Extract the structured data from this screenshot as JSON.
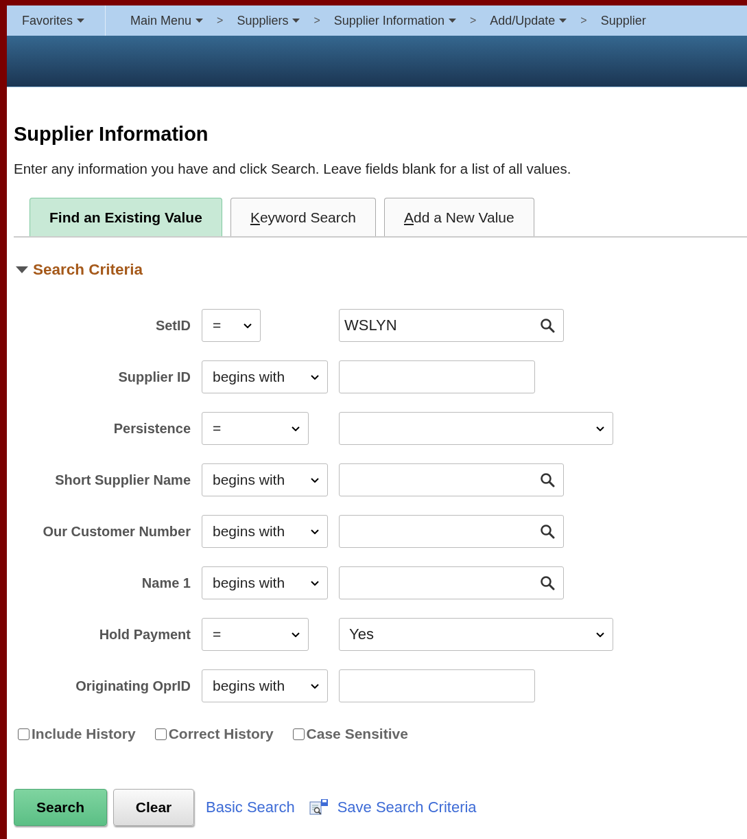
{
  "breadcrumbs": [
    {
      "label": "Favorites",
      "dropdown": true,
      "separator": false
    },
    {
      "label": "Main Menu",
      "dropdown": true,
      "separator": false
    },
    {
      "label": "Suppliers",
      "dropdown": true,
      "separator": true
    },
    {
      "label": "Supplier Information",
      "dropdown": true,
      "separator": true
    },
    {
      "label": "Add/Update",
      "dropdown": true,
      "separator": true
    },
    {
      "label": "Supplier",
      "dropdown": false,
      "separator": true
    }
  ],
  "separator_glyph": ">",
  "page_title": "Supplier Information",
  "instructions": "Enter any information you have and click Search. Leave fields blank for a list of all values.",
  "tabs": [
    {
      "label": "Find an Existing Value",
      "selected": true,
      "access_key_underlined": false
    },
    {
      "label": "Keyword Search",
      "selected": false,
      "access_key_underlined": true
    },
    {
      "label": "Add a New Value",
      "selected": false,
      "access_key_underlined": true
    }
  ],
  "section": {
    "title": "Search Criteria",
    "expanded": true
  },
  "criteria": [
    {
      "label": "SetID",
      "operator": "=",
      "kind": "lookup",
      "value": "WSLYN"
    },
    {
      "label": "Supplier ID",
      "operator": "begins with",
      "kind": "text"
    },
    {
      "label": "Persistence",
      "operator": "=",
      "kind": "dropdown"
    },
    {
      "label": "Short Supplier Name",
      "operator": "begins with",
      "kind": "lookup"
    },
    {
      "label": "Our Customer Number",
      "operator": "begins with",
      "kind": "lookup"
    },
    {
      "label": "Name 1",
      "operator": "begins with",
      "kind": "lookup"
    },
    {
      "label": "Hold Payment",
      "operator": "=",
      "kind": "dropdown",
      "value": "Yes"
    },
    {
      "label": "Originating OprID",
      "operator": "begins with",
      "kind": "text"
    }
  ],
  "options": [
    {
      "label": "Include History",
      "checked": false
    },
    {
      "label": "Correct History",
      "checked": false
    },
    {
      "label": "Case Sensitive",
      "checked": false
    }
  ],
  "buttons": [
    {
      "label": "Search",
      "kind": "primary"
    },
    {
      "label": "Clear",
      "kind": "secondary"
    }
  ],
  "links": [
    {
      "label": "Basic Search",
      "kind": "plain"
    },
    {
      "label": "Save Search Criteria",
      "kind": "with_icon"
    }
  ]
}
